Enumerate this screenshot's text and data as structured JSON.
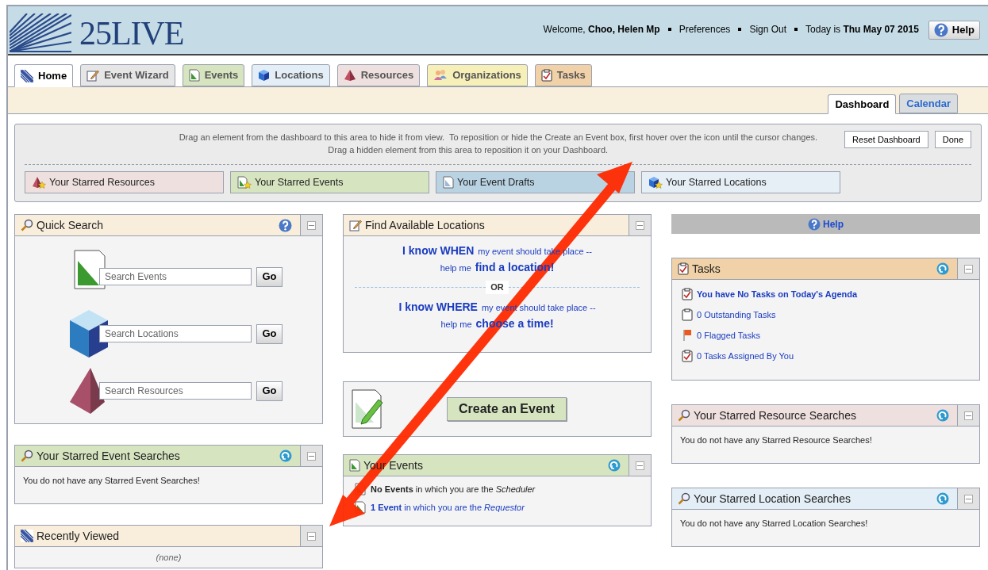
{
  "header": {
    "logo": "25LIVE",
    "welcome": "Welcome,",
    "user": "Choo, Helen Mp",
    "links": [
      "Preferences",
      "Sign Out"
    ],
    "today_label": "Today is",
    "today": "Thu May 07 2015",
    "help": "Help"
  },
  "tabs": [
    {
      "label": "Home",
      "kind": "home",
      "selected": true
    },
    {
      "label": "Event Wizard",
      "kind": "wizard",
      "selected": false
    },
    {
      "label": "Events",
      "kind": "events",
      "selected": false
    },
    {
      "label": "Locations",
      "kind": "locations",
      "selected": false
    },
    {
      "label": "Resources",
      "kind": "resources",
      "selected": false
    },
    {
      "label": "Organizations",
      "kind": "organizations",
      "selected": false
    },
    {
      "label": "Tasks",
      "kind": "tasks",
      "selected": false
    }
  ],
  "subtabs": [
    {
      "label": "Dashboard",
      "selected": true
    },
    {
      "label": "Calendar",
      "selected": false
    }
  ],
  "hidden_area": {
    "instructions": [
      "Drag an element from the dashboard to this area to hide it from view.  To reposition or hide the Create an Event box, first hover over the icon until the cursor changes.",
      "Drag a hidden element from this area to reposition it on your Dashboard."
    ],
    "buttons": [
      "Reset Dashboard",
      "Done"
    ],
    "items": [
      {
        "label": "Your Starred Resources",
        "kind": "resources",
        "color": "#eee0de"
      },
      {
        "label": "Your Starred Events",
        "kind": "events",
        "color": "#d6e4c0"
      },
      {
        "label": "Your Event Drafts",
        "kind": "drafts",
        "color": "#b9d3e3"
      },
      {
        "label": "Your Starred Locations",
        "kind": "locations",
        "color": "#e6eff6"
      }
    ]
  },
  "columns": [
    [
      {
        "kind": "quick_search",
        "title": "Quick Search",
        "color": "#f8eedb",
        "searches": [
          {
            "kind": "events",
            "placeholder": "Search Events",
            "button": "Go"
          },
          {
            "kind": "locations",
            "placeholder": "Search Locations",
            "button": "Go"
          },
          {
            "kind": "resources",
            "placeholder": "Search Resources",
            "button": "Go"
          }
        ]
      },
      {
        "kind": "message",
        "title": "Your Starred Event Searches",
        "color": "#d6e4c0",
        "message": "You do not have any Starred Event Searches!"
      },
      {
        "kind": "recent",
        "title": "Recently Viewed",
        "color": "#f8eedb",
        "message": "(none)"
      }
    ],
    [
      {
        "kind": "find_locations",
        "title": "Find Available Locations",
        "color": "#f8eedb",
        "divider": "OR",
        "lines": [
          [
            {
              "text": "I know WHEN",
              "emphasis": true
            },
            {
              "text": "my event should take place --",
              "emphasis": false
            }
          ],
          [
            {
              "text": "help me",
              "emphasis": false
            },
            {
              "text": "find a location!",
              "emphasis": true
            }
          ],
          [
            {
              "text": "I know WHERE",
              "emphasis": true
            },
            {
              "text": "my event should take place --",
              "emphasis": false
            }
          ],
          [
            {
              "text": "help me",
              "emphasis": false
            },
            {
              "text": "choose a time!",
              "emphasis": true
            }
          ]
        ]
      },
      {
        "kind": "create_event",
        "button": "Create an Event"
      },
      {
        "kind": "your_events",
        "title": "Your Events",
        "color": "#d6e4c0",
        "items": [
          {
            "text": "**No Events** in which you are the *Scheduler*",
            "link": false
          },
          {
            "text": "**1 Event** in which you are the *Requestor*",
            "link": true
          }
        ]
      }
    ],
    [
      {
        "kind": "help_bar",
        "label": "Help"
      },
      {
        "kind": "tasks",
        "title": "Tasks",
        "color": "#f1d1a7",
        "items": [
          {
            "kind": "agenda",
            "text": "You have No Tasks on Today's Agenda",
            "emphasis": true
          },
          {
            "kind": "outstanding",
            "text": "0 Outstanding Tasks",
            "emphasis": false
          },
          {
            "kind": "flagged",
            "text": "0 Flagged Tasks",
            "emphasis": false
          },
          {
            "kind": "assigned",
            "text": "0 Tasks Assigned By You",
            "emphasis": false
          }
        ]
      },
      {
        "kind": "message",
        "title": "Your Starred Resource Searches",
        "color": "#eee0de",
        "message": "You do not have any Starred Resource Searches!"
      },
      {
        "kind": "message",
        "title": "Your Starred Location Searches",
        "color": "#e3eef6",
        "message": "You do not have any Starred Location Searches!"
      }
    ]
  ]
}
